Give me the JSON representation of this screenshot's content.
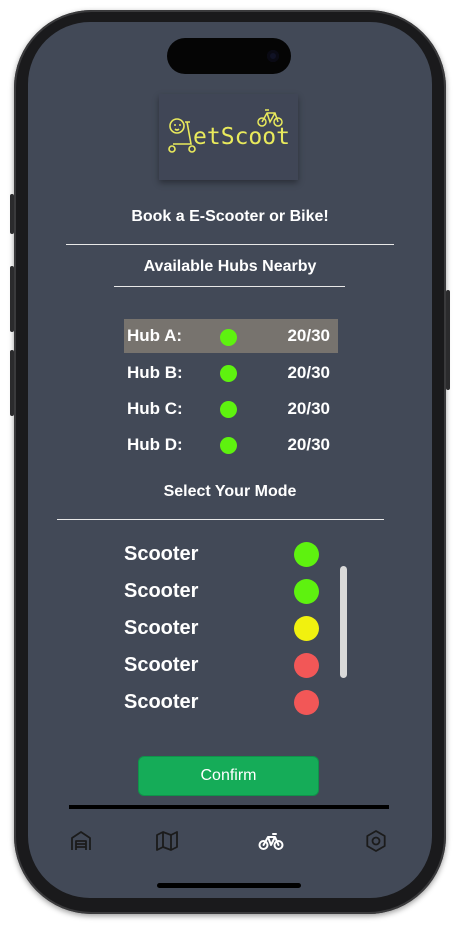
{
  "app": {
    "logo_text": "etScoot",
    "logo_color": "#e9ea5c",
    "background": "#424957"
  },
  "header": {
    "tagline": "Book a E-Scooter or Bike!"
  },
  "hubs": {
    "title": "Available Hubs Nearby",
    "items": [
      {
        "name": "Hub A:",
        "count": "20/30",
        "status_color": "#5ef20f",
        "selected": true
      },
      {
        "name": "Hub B:",
        "count": "20/30",
        "status_color": "#5ef20f",
        "selected": false
      },
      {
        "name": "Hub C:",
        "count": "20/30",
        "status_color": "#5ef20f",
        "selected": false
      },
      {
        "name": "Hub D:",
        "count": "20/30",
        "status_color": "#5ef20f",
        "selected": false
      }
    ]
  },
  "modes": {
    "title": "Select Your Mode",
    "items": [
      {
        "label": "Scooter",
        "status_color": "#5ef20f"
      },
      {
        "label": "Scooter",
        "status_color": "#5ef20f"
      },
      {
        "label": "Scooter",
        "status_color": "#f1f10f"
      },
      {
        "label": "Scooter",
        "status_color": "#f25757"
      },
      {
        "label": "Scooter",
        "status_color": "#f25757"
      }
    ]
  },
  "confirm_label": "Confirm",
  "accent": "#15ac58",
  "tabbar": {
    "tabs": [
      {
        "icon": "garage-icon",
        "active": false
      },
      {
        "icon": "map-icon",
        "active": false
      },
      {
        "icon": "bike-icon",
        "active": true
      },
      {
        "icon": "settings-icon",
        "active": false
      }
    ]
  }
}
